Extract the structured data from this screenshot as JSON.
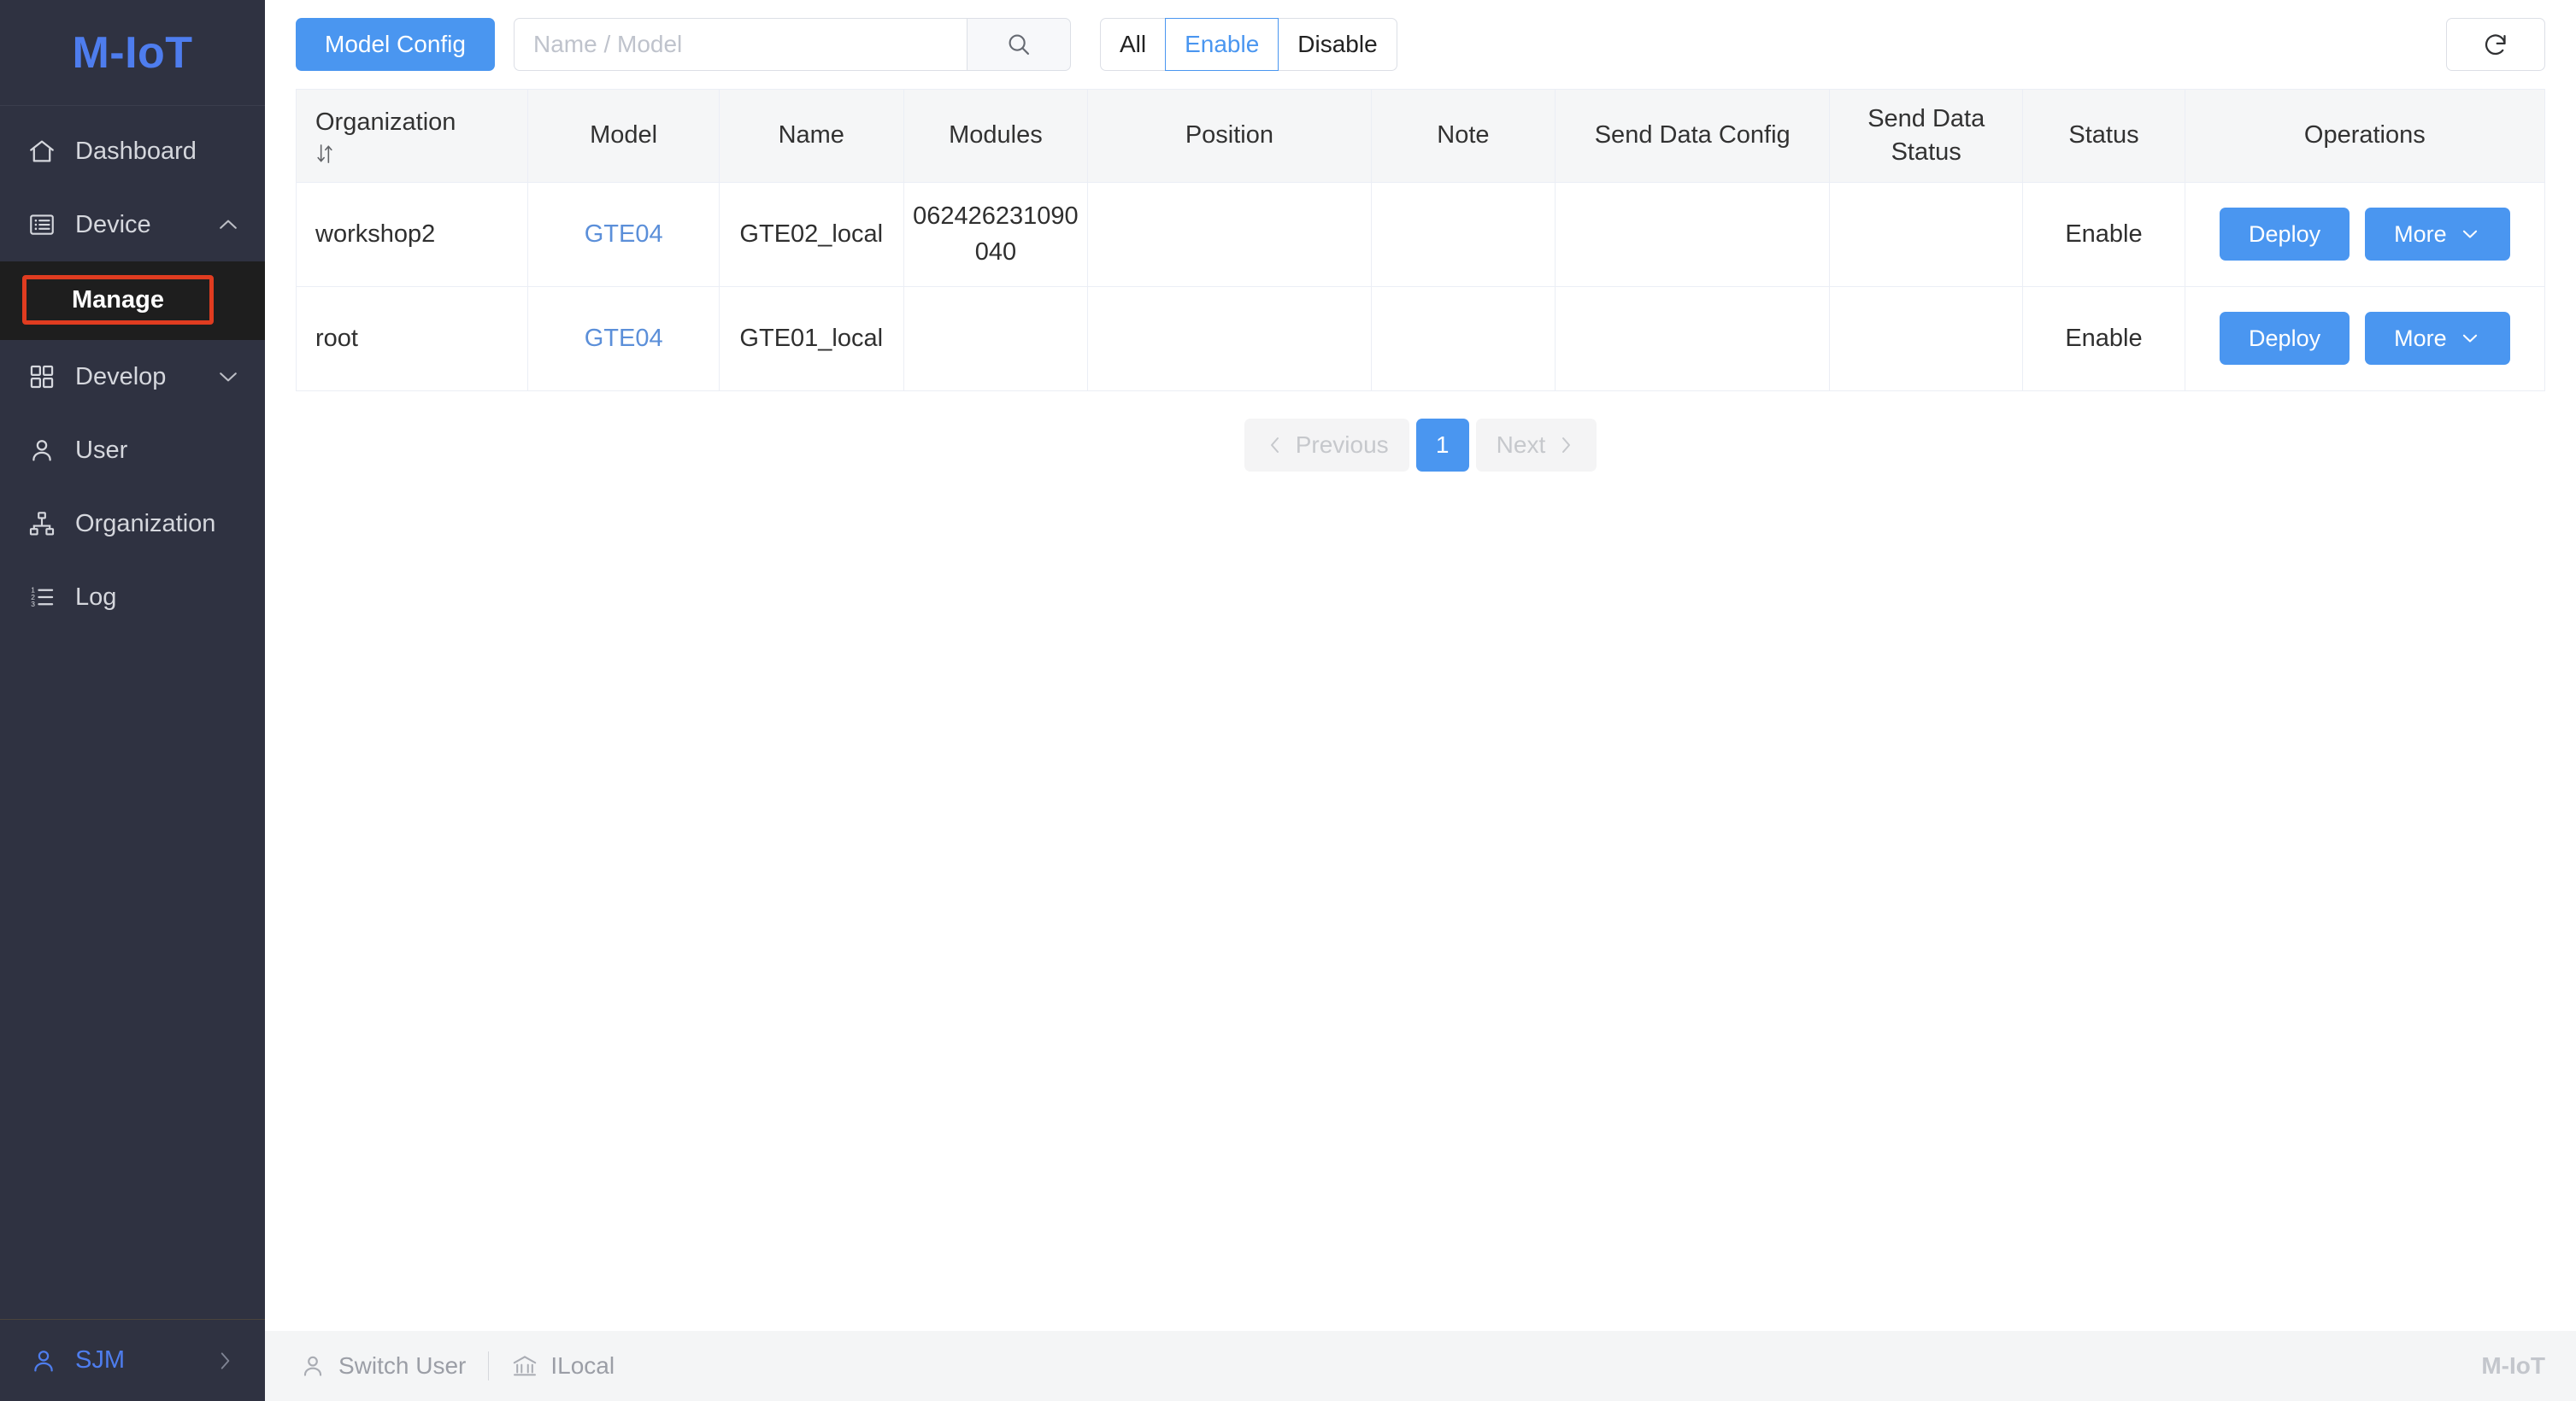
{
  "sidebar": {
    "brand": "M-IoT",
    "items": [
      {
        "label": "Dashboard",
        "icon": "home-icon",
        "expandable": false
      },
      {
        "label": "Device",
        "icon": "device-list-icon",
        "expandable": true,
        "expanded": true
      },
      {
        "label": "Develop",
        "icon": "grid-icon",
        "expandable": true,
        "expanded": false
      },
      {
        "label": "User",
        "icon": "user-icon",
        "expandable": false
      },
      {
        "label": "Organization",
        "icon": "org-tree-icon",
        "expandable": false
      },
      {
        "label": "Log",
        "icon": "ordered-list-icon",
        "expandable": false
      }
    ],
    "submenu": {
      "parent": "Device",
      "label": "Manage",
      "highlight_color": "#e03c20"
    },
    "user": {
      "name": "SJM",
      "icon": "user-icon",
      "arrow": "chevron-right-icon"
    }
  },
  "toolbar": {
    "model_config_label": "Model Config",
    "search": {
      "value": "",
      "placeholder": "Name / Model",
      "icon": "search-icon"
    },
    "filters": [
      {
        "label": "All",
        "active": false
      },
      {
        "label": "Enable",
        "active": true
      },
      {
        "label": "Disable",
        "active": false
      }
    ],
    "refresh_icon": "refresh-icon"
  },
  "table": {
    "columns": [
      {
        "label": "Organization",
        "sortable": true,
        "sort_icon": "sort-icon"
      },
      {
        "label": "Model",
        "sortable": false
      },
      {
        "label": "Name",
        "sortable": false
      },
      {
        "label": "Modules",
        "sortable": false
      },
      {
        "label": "Position",
        "sortable": false
      },
      {
        "label": "Note",
        "sortable": false
      },
      {
        "label": "Send Data Config",
        "sortable": false
      },
      {
        "label": "Send Data Status",
        "sortable": false
      },
      {
        "label": "Status",
        "sortable": false
      },
      {
        "label": "Operations",
        "sortable": false
      }
    ],
    "rows": [
      {
        "organization": "workshop2",
        "model": "GTE04",
        "name": "GTE02_local",
        "modules": "062426231090040",
        "position": "",
        "note": "",
        "send_data_config": "",
        "send_data_status": "",
        "status": "Enable",
        "operations": {
          "deploy": "Deploy",
          "more": "More",
          "more_icon": "chevron-down-icon"
        }
      },
      {
        "organization": "root",
        "model": "GTE04",
        "name": "GTE01_local",
        "modules": "",
        "position": "",
        "note": "",
        "send_data_config": "",
        "send_data_status": "",
        "status": "Enable",
        "operations": {
          "deploy": "Deploy",
          "more": "More",
          "more_icon": "chevron-down-icon"
        }
      }
    ]
  },
  "pagination": {
    "previous": "Previous",
    "next": "Next",
    "pages": [
      "1"
    ],
    "current_page": "1",
    "prev_icon": "chevron-left-icon",
    "next_icon": "chevron-right-icon"
  },
  "footer": {
    "switch_user": "Switch User",
    "switch_user_icon": "user-icon",
    "tenant": "ILocal",
    "tenant_icon": "bank-icon",
    "brand": "M-IoT"
  },
  "colors": {
    "accent": "#4a96f0",
    "brand": "#4e7dee",
    "sidebar_bg": "#2f3241",
    "submenu_bg": "#1e1e1e",
    "highlight": "#e03c20",
    "link": "#5b8fd9",
    "header_bg": "#f5f6f7"
  }
}
